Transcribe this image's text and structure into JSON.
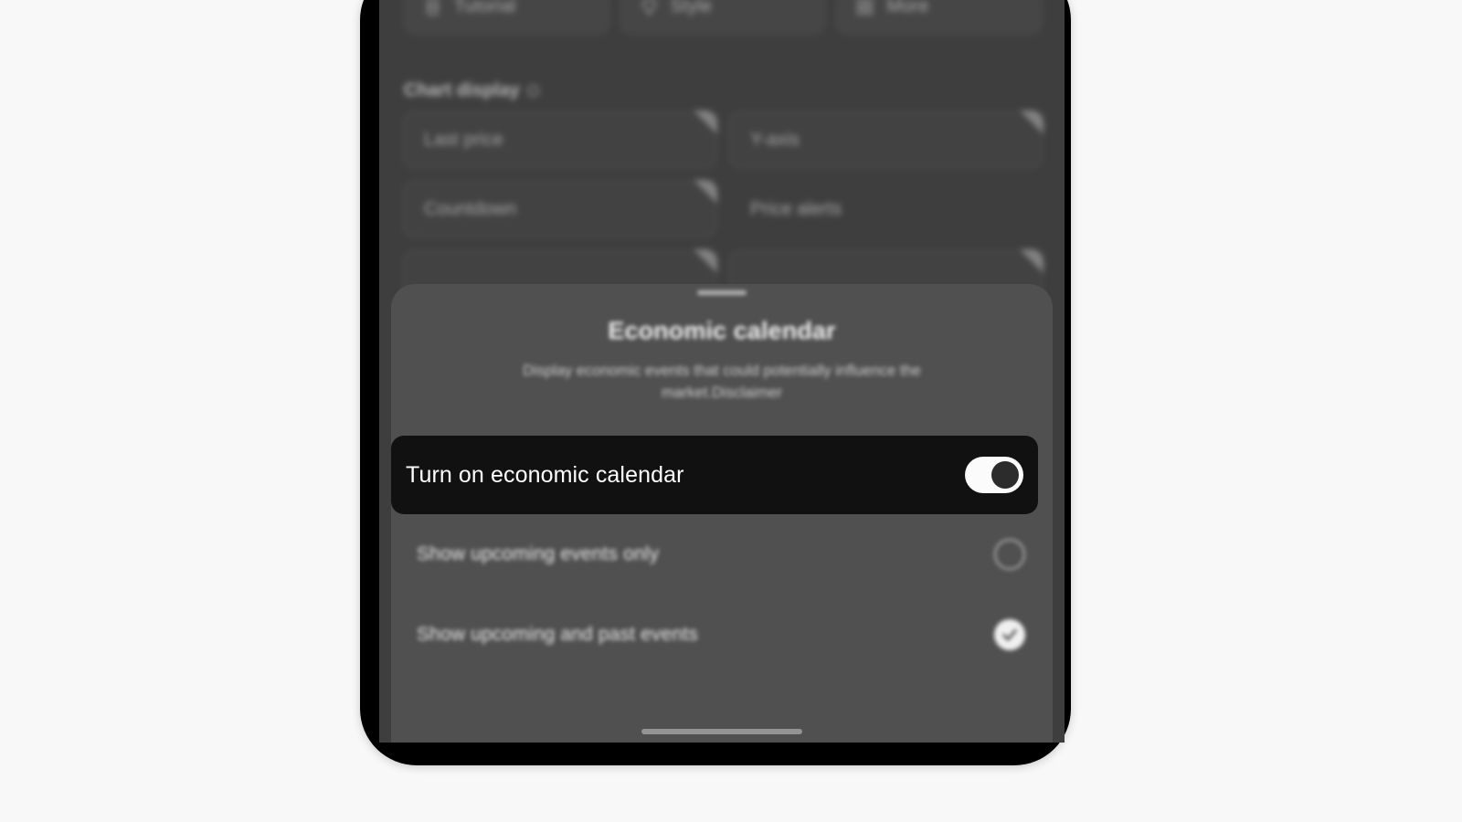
{
  "background_page": {
    "tabs": [
      {
        "label": "Tutorial",
        "icon": "book-icon"
      },
      {
        "label": "Style",
        "icon": "diamond-icon"
      },
      {
        "label": "More",
        "icon": "grid-icon"
      }
    ],
    "section_label": "Chart display",
    "section_info_icon": "info-circle-icon",
    "cards": [
      {
        "label": "Last price",
        "badge": true
      },
      {
        "label": "Y-axis",
        "badge": true
      },
      {
        "label": "Countdown",
        "badge": true
      },
      {
        "label": "Price alerts",
        "badge": false
      },
      {
        "label": "",
        "badge": true
      },
      {
        "label": "",
        "badge": true
      }
    ]
  },
  "sheet": {
    "drag_handle": "sheet-drag-handle",
    "title": "Economic calendar",
    "subtitle": "Display economic events that could potentially influence the market.Disclaimer",
    "focus_row": {
      "label": "Turn on economic calendar",
      "toggle_state": "on",
      "toggle_icon": "toggle-switch-on"
    },
    "options": [
      {
        "label": "Show upcoming events only",
        "selected": false,
        "icon": "radio-unselected-icon"
      },
      {
        "label": "Show upcoming and past events",
        "selected": true,
        "icon": "radio-selected-check-icon"
      }
    ]
  },
  "device": {
    "home_indicator": "home-indicator"
  },
  "colors": {
    "page_background": "#f8f8f8",
    "device_bezel": "#000000",
    "screen_background": "#4b4b4b",
    "sheet_background": "#505050",
    "focus_row_background": "#111111",
    "toggle_track_on": "#fbfbfb",
    "toggle_knob": "#2c2c2c",
    "accent_text": "#ffffff"
  }
}
